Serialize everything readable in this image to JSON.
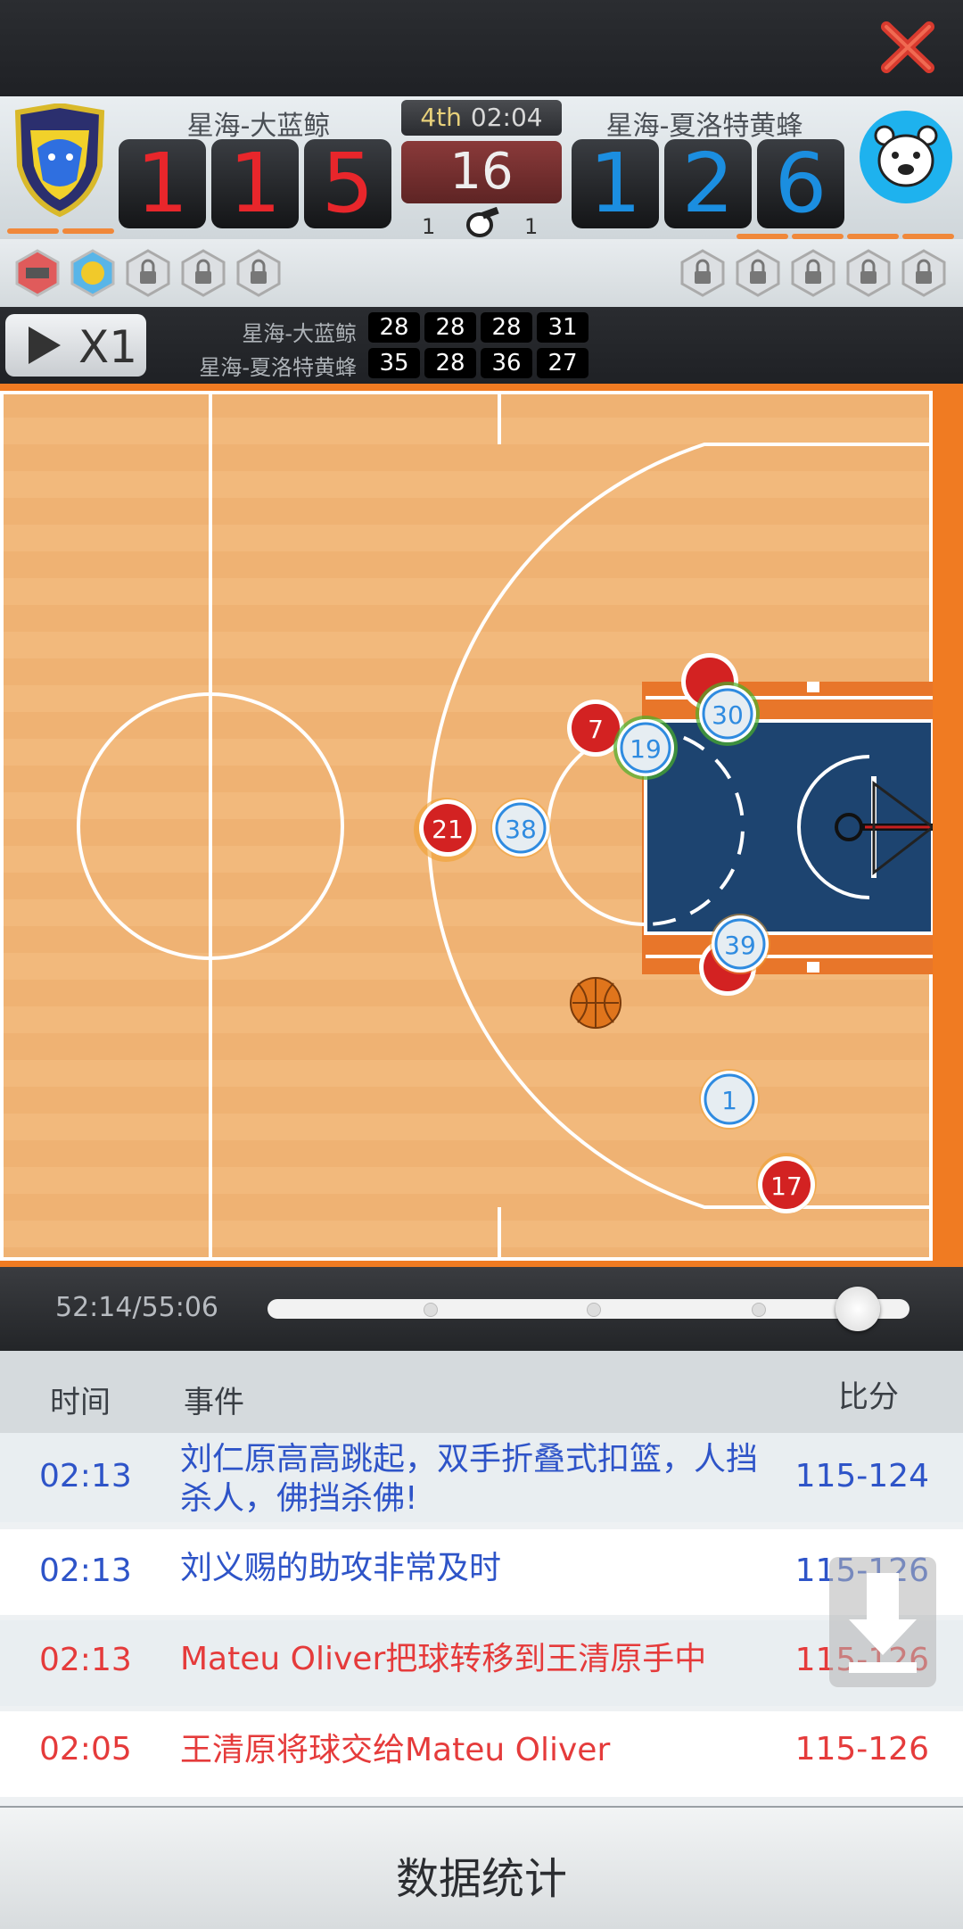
{
  "colors": {
    "home_digit": "#e8262b",
    "away_digit": "#1b8ee0",
    "accent_orange": "#f07b22",
    "log_blue": "#2e54c8",
    "log_red": "#e53b3b"
  },
  "header": {
    "close_icon": "close-x-icon"
  },
  "scoreboard": {
    "home": {
      "name": "星海-大蓝鲸",
      "digits": [
        "1",
        "1",
        "5"
      ],
      "fouls": "1",
      "logo_icon": "dragon-shield-icon"
    },
    "away": {
      "name": "星海-夏洛特黄蜂",
      "digits": [
        "1",
        "2",
        "6"
      ],
      "fouls": "1",
      "logo_icon": "bear-icon"
    },
    "quarter": "4th",
    "clock": "02:04",
    "shot_clock": "16",
    "whistle_icon": "whistle-icon"
  },
  "badges": {
    "locked_icon": "lock-icon"
  },
  "controls": {
    "speed_label": "X1",
    "quarter_scores": [
      {
        "team": "星海-大蓝鲸",
        "q": [
          "28",
          "28",
          "28",
          "31"
        ]
      },
      {
        "team": "星海-夏洛特黄蜂",
        "q": [
          "35",
          "28",
          "36",
          "27"
        ]
      }
    ]
  },
  "court": {
    "players_red": [
      "21",
      "7",
      "17"
    ],
    "players_blue": [
      "38",
      "19",
      "30",
      "39",
      "1"
    ]
  },
  "timeline": {
    "time": "52:14/55:06",
    "progress": 0.95
  },
  "log": {
    "headers": {
      "time": "时间",
      "event": "事件",
      "score": "比分"
    },
    "rows": [
      {
        "time": "02:13",
        "event": "刘仁原高高跳起，双手折叠式扣篮，人挡杀人，佛挡杀佛!",
        "score": "115-124"
      },
      {
        "time": "02:13",
        "event": "刘义赐的助攻非常及时",
        "score": "115-126"
      },
      {
        "time": "02:13",
        "event": "Mateu Oliver把球转移到王清原手中",
        "score": "115-126"
      },
      {
        "time": "02:05",
        "event": "王清原将球交给Mateu Oliver",
        "score": "115-126"
      }
    ]
  },
  "footer": {
    "stats_label": "数据统计",
    "download_icon": "download-icon"
  }
}
